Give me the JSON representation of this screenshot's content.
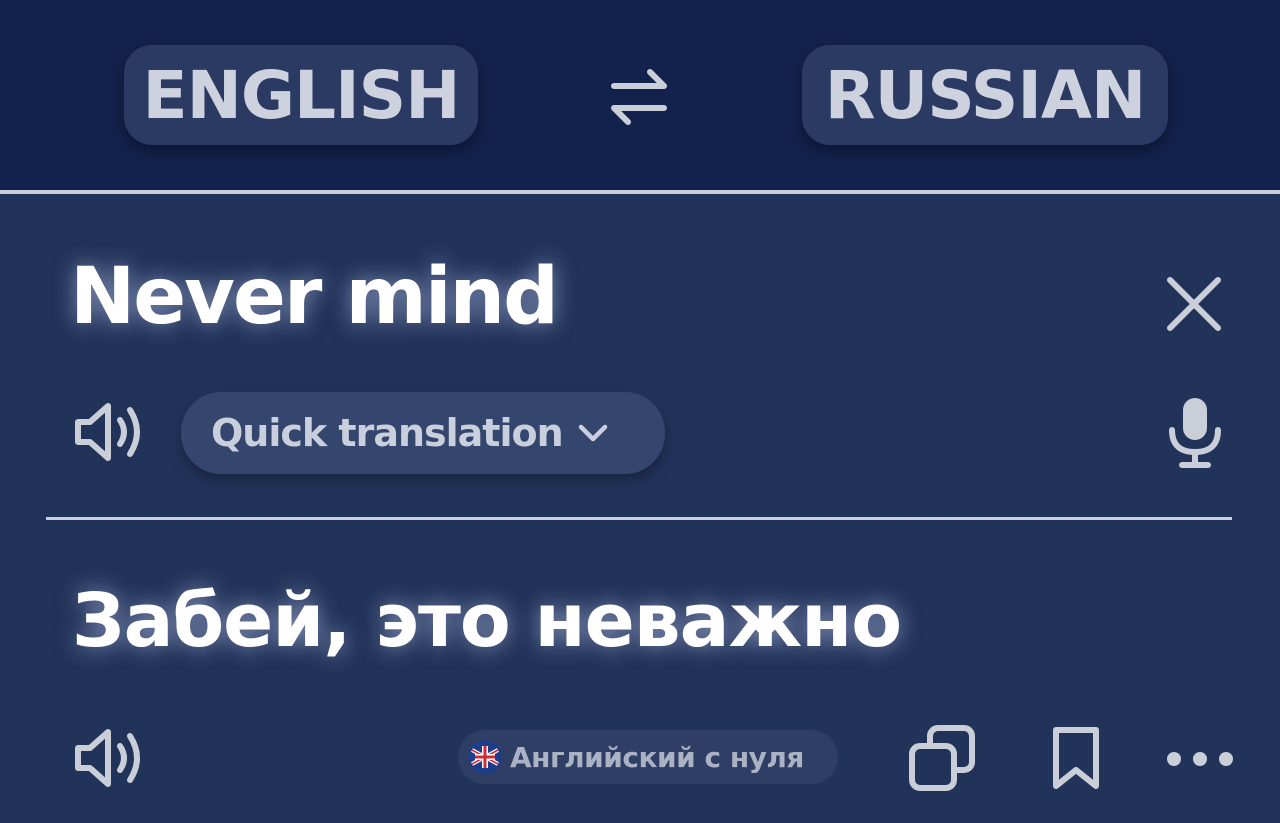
{
  "header": {
    "source_language": "ENGLISH",
    "target_language": "RUSSIAN",
    "swap_icon": "swap-arrows-icon"
  },
  "source": {
    "text": "Never mind",
    "mode_label": "Quick translation",
    "icons": [
      "speaker-icon",
      "close-icon",
      "chevron-down-icon",
      "microphone-icon"
    ]
  },
  "result": {
    "text": "Забей, это неважно",
    "watermark": "Английский с нуля",
    "icons": [
      "speaker-icon",
      "flag-icon",
      "copy-icon",
      "bookmark-icon",
      "more-icon"
    ]
  },
  "colors": {
    "header_bg": "#13224c",
    "panel_bg": "#22335a",
    "pill_bg": "#2a3a62",
    "text_primary": "#ffffff",
    "text_secondary": "#cdd2de"
  }
}
